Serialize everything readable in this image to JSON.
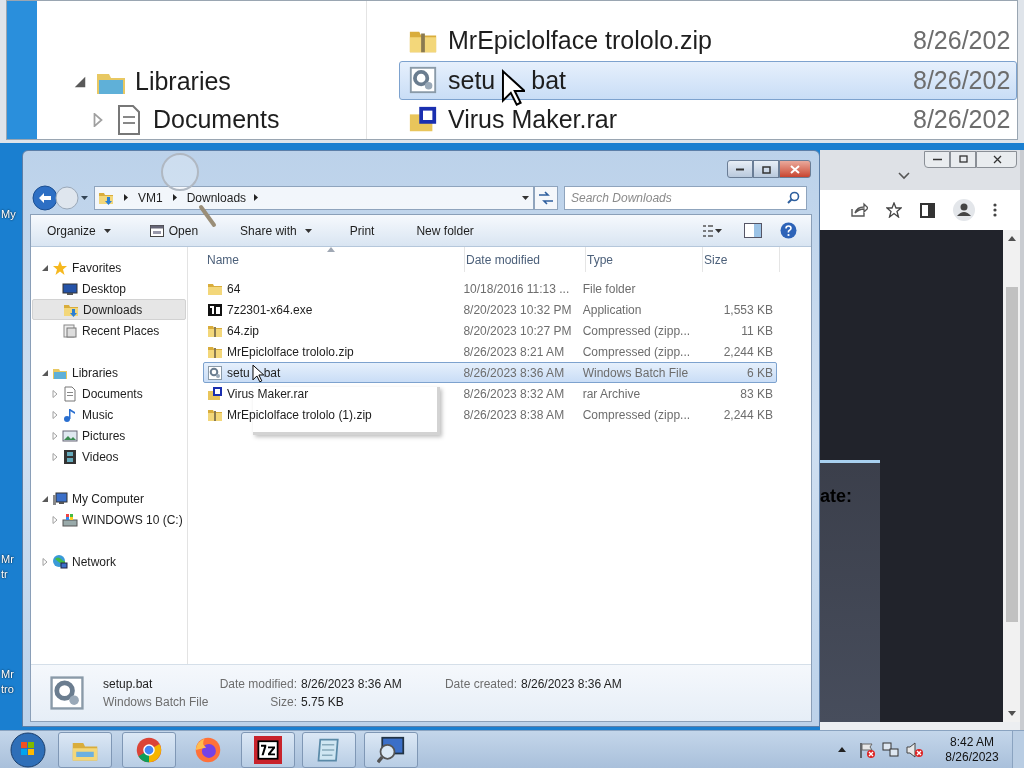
{
  "magnifier": {
    "nav": [
      {
        "label": "Libraries",
        "kind": "libraries",
        "expanded": true
      },
      {
        "label": "Documents",
        "kind": "documents",
        "expanded": false
      }
    ],
    "files": [
      {
        "name": "MrEpiclolface trololo.zip",
        "date": "8/26/202",
        "kind": "zip",
        "selected": false
      },
      {
        "name": "setu bat",
        "date": "8/26/202",
        "kind": "bat",
        "selected": true
      },
      {
        "name": "Virus Maker.rar",
        "date": "8/26/202",
        "kind": "rar",
        "selected": false
      }
    ]
  },
  "desktop_labels": [
    "My",
    "Mr",
    "tr",
    "Mr",
    "tro"
  ],
  "browser": {
    "page_text": "ate:"
  },
  "explorer": {
    "breadcrumb": [
      "VM1",
      "Downloads"
    ],
    "search": {
      "placeholder": "Search Downloads"
    },
    "toolbar": [
      {
        "label": "Organize",
        "kind": "text",
        "dropdown": true
      },
      {
        "label": "Open",
        "kind": "icon",
        "dropdown": false
      },
      {
        "label": "Share with",
        "kind": "text",
        "dropdown": true
      },
      {
        "label": "Print",
        "kind": "text",
        "dropdown": false
      },
      {
        "label": "New folder",
        "kind": "text",
        "dropdown": false
      }
    ],
    "nav": [
      {
        "label": "Favorites",
        "kind": "star",
        "expanded": true,
        "children": [
          {
            "label": "Desktop",
            "kind": "desktop",
            "selected": false
          },
          {
            "label": "Downloads",
            "kind": "downloads",
            "selected": true
          },
          {
            "label": "Recent Places",
            "kind": "recent",
            "selected": false
          }
        ]
      },
      {
        "label": "Libraries",
        "kind": "libraries",
        "expanded": true,
        "children": [
          {
            "label": "Documents",
            "kind": "documents",
            "expanded": false,
            "selected": false
          },
          {
            "label": "Music",
            "kind": "music",
            "expanded": false,
            "selected": false
          },
          {
            "label": "Pictures",
            "kind": "pictures",
            "expanded": false,
            "selected": false
          },
          {
            "label": "Videos",
            "kind": "videos",
            "expanded": false,
            "selected": false
          }
        ]
      },
      {
        "label": "My Computer",
        "kind": "computer",
        "expanded": true,
        "children": [
          {
            "label": "WINDOWS 10 (C:)",
            "kind": "drive",
            "expanded": false,
            "selected": false
          }
        ]
      },
      {
        "label": "Network",
        "kind": "network",
        "expanded": false
      }
    ],
    "columns": [
      "Name",
      "Date modified",
      "Type",
      "Size"
    ],
    "files": [
      {
        "name": "64",
        "date": "10/18/2016 11:13 ...",
        "type": "File folder",
        "kind": "folder",
        "selected": false
      },
      {
        "name": "7z2301-x64.exe",
        "date": "8/20/2023 10:32 PM",
        "type": "Application",
        "size": "1,553 KB",
        "kind": "app",
        "selected": false
      },
      {
        "name": "64.zip",
        "date": "8/20/2023 10:27 PM",
        "type": "Compressed (zipp...",
        "size": "11 KB",
        "kind": "zip",
        "selected": false
      },
      {
        "name": "MrEpiclolface trololo.zip",
        "date": "8/26/2023 8:21 AM",
        "type": "Compressed (zipp...",
        "size": "2,244 KB",
        "kind": "zip",
        "selected": false
      },
      {
        "name": "setu bat",
        "date": "8/26/2023 8:36 AM",
        "type": "Windows Batch File",
        "size": "6 KB",
        "kind": "bat",
        "selected": true
      },
      {
        "name": "Virus Maker.rar",
        "date": "8/26/2023 8:32 AM",
        "type": "rar Archive",
        "size": "83 KB",
        "kind": "rar",
        "selected": false
      },
      {
        "name": "MrEpiclolface trololo (1).zip",
        "date": "8/26/2023 8:38 AM",
        "type": "Compressed (zipp...",
        "size": "2,244 KB",
        "kind": "zip",
        "selected": false
      }
    ],
    "details": {
      "name": "setup.bat",
      "type": "Windows Batch File",
      "kind": "bat",
      "fields": [
        {
          "label": "Date modified:",
          "value": "8/26/2023 8:36 AM"
        },
        {
          "label": "Size:",
          "value": "5.75 KB"
        },
        {
          "label": "Date created:",
          "value": "8/26/2023 8:36 AM"
        }
      ]
    }
  },
  "taskbar": {
    "apps": [
      {
        "kind": "explorer",
        "running": true
      },
      {
        "kind": "chrome",
        "running": true
      },
      {
        "kind": "firefox",
        "running": false
      },
      {
        "kind": "sevenzip",
        "running": true
      },
      {
        "kind": "notepad",
        "running": true
      },
      {
        "kind": "magnifier",
        "running": true
      }
    ],
    "clock": {
      "time": "8:42 AM",
      "date": "8/26/2023"
    }
  }
}
